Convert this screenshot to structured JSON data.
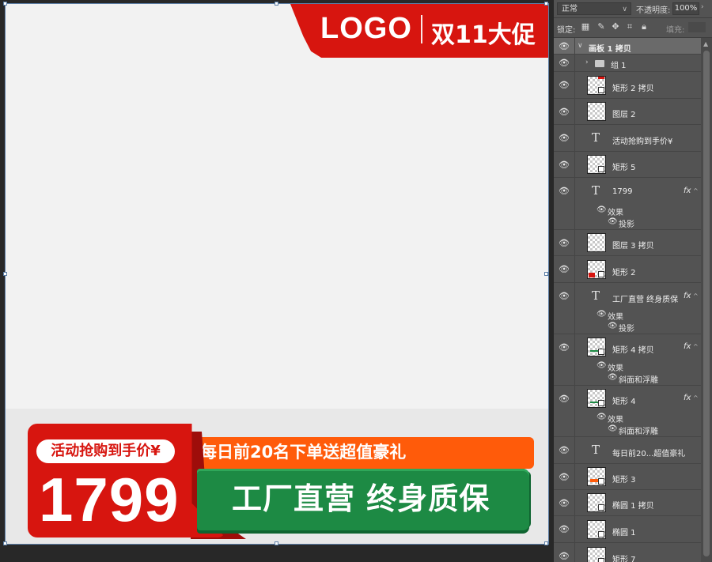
{
  "artboard": {
    "logo_text": "LOGO",
    "logo_promo": "双11大促",
    "activity_label": "活动抢购到手价¥",
    "price": "1799",
    "orange_bar_text": "每日前20名下单送超值豪礼",
    "green_bar_text": "工厂直营 终身质保"
  },
  "panel": {
    "blend_mode": "正常",
    "opacity_label": "不透明度:",
    "opacity_value": "100%",
    "lock_label": "锁定:",
    "fill_label": "填充:",
    "layers": [
      {
        "name": "画板 1 拷贝",
        "kind": "artboard"
      },
      {
        "name": "组 1",
        "kind": "group"
      },
      {
        "name": "矩形 2 拷贝",
        "kind": "shape"
      },
      {
        "name": "图层 2",
        "kind": "pixel"
      },
      {
        "name": "活动抢购到手价¥",
        "kind": "text"
      },
      {
        "name": "矩形 5",
        "kind": "shape"
      },
      {
        "name": "1799",
        "kind": "text",
        "fx": "fx",
        "effects_label": "效果",
        "effects": [
          "投影"
        ]
      },
      {
        "name": "图层 3 拷贝",
        "kind": "pixel"
      },
      {
        "name": "矩形 2",
        "kind": "shape"
      },
      {
        "name": "工厂直营 终身质保",
        "kind": "text",
        "fx": "fx",
        "effects_label": "效果",
        "effects": [
          "投影"
        ]
      },
      {
        "name": "矩形 4 拷贝",
        "kind": "shape",
        "fx": "fx",
        "effects_label": "效果",
        "effects": [
          "斜面和浮雕"
        ]
      },
      {
        "name": "矩形 4",
        "kind": "shape",
        "fx": "fx",
        "effects_label": "效果",
        "effects": [
          "斜面和浮雕"
        ]
      },
      {
        "name": "每日前20...超值豪礼",
        "kind": "text"
      },
      {
        "name": "矩形 3",
        "kind": "shape"
      },
      {
        "name": "椭圆 1 拷贝",
        "kind": "shape"
      },
      {
        "name": "椭圆 1",
        "kind": "shape"
      },
      {
        "name": "矩形 7",
        "kind": "shape"
      }
    ]
  },
  "colors": {
    "brand_red": "#d7150f",
    "orange": "#ff5b0a",
    "green": "#1d8a44"
  }
}
